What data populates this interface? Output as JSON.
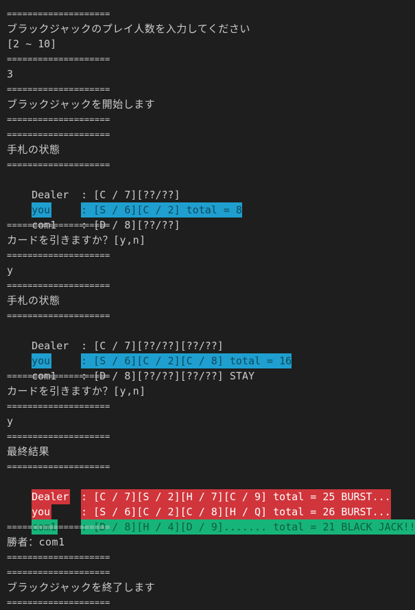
{
  "terminal": {
    "separator": "====================",
    "prompt_players": "ブラックジャックのプレイ人数を入力してください",
    "player_range": "[2 ~ 10]",
    "input_players": "3",
    "start_message": "ブラックジャックを開始します",
    "hand_status_1": "手札の状態",
    "round1": {
      "dealer_name": "Dealer",
      "dealer_hand": ": [C / 7][??/??]",
      "you_name": "you",
      "you_hand": ": [S / 6][C / 2] total = 8",
      "com1_name": "com1",
      "com1_hand": ": [D / 8][??/??]"
    },
    "draw_prompt_1": "カードを引きますか？[y,n]",
    "answer_1": "y",
    "hand_status_2": "手札の状態",
    "round2": {
      "dealer_name": "Dealer",
      "dealer_hand": ": [C / 7][??/??][??/??]",
      "you_name": "you",
      "you_hand": ": [S / 6][C / 2][C / 8] total = 16",
      "com1_name": "com1",
      "com1_hand": ": [D / 8][??/??][??/??] STAY"
    },
    "draw_prompt_2": "カードを引きますか？[y,n]",
    "answer_2": "y",
    "final_result_label": "最終結果",
    "final": {
      "dealer_name": "Dealer",
      "dealer_hand": ": [C / 7][S / 2][H / 7][C / 9] total = 25 BURST...",
      "you_name": "you",
      "you_hand": ": [S / 6][C / 2][C / 8][H / Q] total = 26 BURST...",
      "com1_name": "com1",
      "com1_hand": ": [D / 8][H / 4][D / 9]....... total = 21 BLACK JACK!!"
    },
    "winner": "勝者：com1",
    "end_message": "ブラックジャックを終了します"
  },
  "colors": {
    "background": "#1e1e1e",
    "text": "#cccccc",
    "highlight_you": "#1f9fcf",
    "highlight_burst": "#d0353b",
    "highlight_blackjack": "#17b47a"
  }
}
